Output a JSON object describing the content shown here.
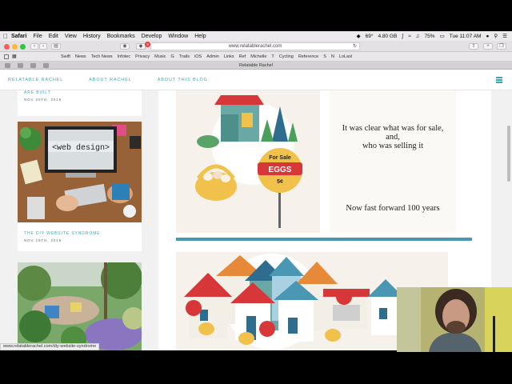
{
  "menubar": {
    "app": "Safari",
    "items": [
      "File",
      "Edit",
      "View",
      "History",
      "Bookmarks",
      "Develop",
      "Window",
      "Help"
    ],
    "status": {
      "temperature": "69°",
      "memory": "4.80 GB",
      "battery": "75%",
      "clock": "Tue 11:07 AM"
    }
  },
  "toolbar": {
    "url": "www.relatablerachel.com",
    "badge": "8"
  },
  "bookmarks": [
    "Swift",
    "News",
    "Tech News",
    "Infotec",
    "Privacy",
    "Music",
    "G",
    "Trails",
    "iOS",
    "Admin",
    "Links",
    "Ref",
    "Michelle",
    "T",
    "Cycling",
    "Reference",
    "S",
    "N",
    "LoLasl"
  ],
  "tab": {
    "title": "Relatable Rachel"
  },
  "site": {
    "nav": [
      "Relatable Rachel",
      "About Rachel",
      "About This Blog"
    ]
  },
  "posts": [
    {
      "title": "Are Built",
      "date": "Nov 20th, 2016"
    },
    {
      "title": "The DIY Website Syndrome",
      "date": "Nov 19th, 2016",
      "image_text": "<web design>"
    }
  ],
  "article": {
    "sign_top": "For Sale",
    "sign_main": "EGGS",
    "sign_price": "5¢",
    "caption1_lines": [
      "It was clear what was for sale,",
      "and,",
      "who was selling it"
    ],
    "caption2": "Now fast forward 100 years"
  },
  "statusbar": {
    "link": "www.relatablerachel.com/diy-website-syndrome"
  },
  "colors": {
    "accent": "#3aa7b6",
    "divider": "#4a97b4",
    "sign_red": "#d8373a",
    "basket": "#f0c24c"
  }
}
